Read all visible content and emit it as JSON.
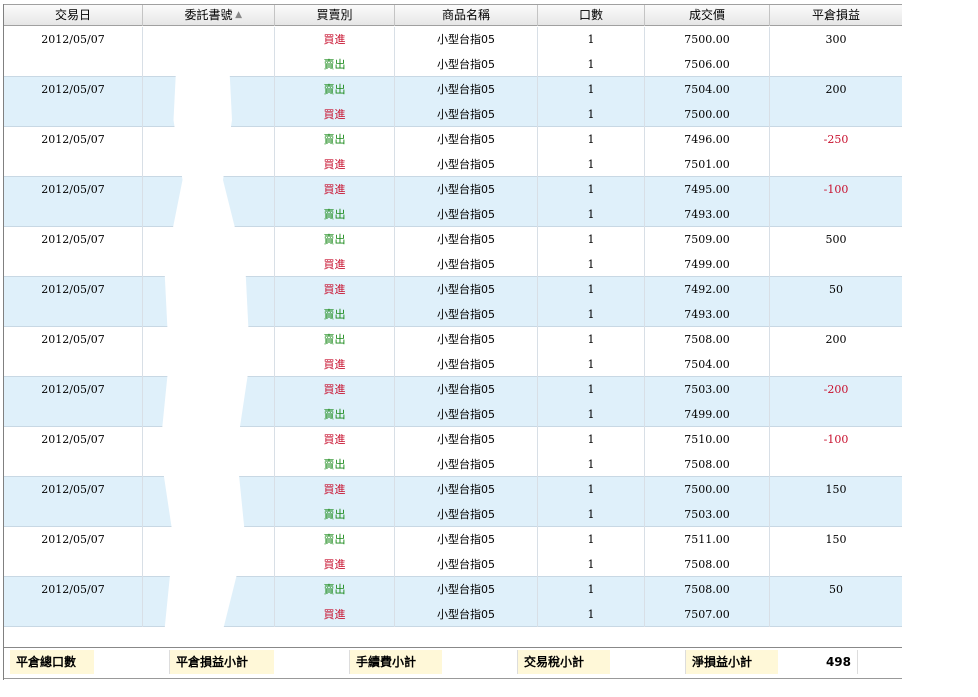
{
  "columns": [
    {
      "key": "date",
      "label": "交易日"
    },
    {
      "key": "order",
      "label": "委託書號"
    },
    {
      "key": "side",
      "label": "買賣別"
    },
    {
      "key": "product",
      "label": "商品名稱"
    },
    {
      "key": "qty",
      "label": "口數"
    },
    {
      "key": "price",
      "label": "成交價"
    },
    {
      "key": "pnl",
      "label": "平倉損益"
    }
  ],
  "sort_indicator": "▲",
  "rows": [
    {
      "date": "2012/05/07",
      "side": "買進",
      "product": "小型台指05",
      "qty": "1",
      "price": "7500.00",
      "pnl": "300"
    },
    {
      "date": "",
      "side": "賣出",
      "product": "小型台指05",
      "qty": "1",
      "price": "7506.00",
      "pnl": ""
    },
    {
      "date": "2012/05/07",
      "side": "賣出",
      "product": "小型台指05",
      "qty": "1",
      "price": "7504.00",
      "pnl": "200"
    },
    {
      "date": "",
      "side": "買進",
      "product": "小型台指05",
      "qty": "1",
      "price": "7500.00",
      "pnl": ""
    },
    {
      "date": "2012/05/07",
      "side": "賣出",
      "product": "小型台指05",
      "qty": "1",
      "price": "7496.00",
      "pnl": "-250"
    },
    {
      "date": "",
      "side": "買進",
      "product": "小型台指05",
      "qty": "1",
      "price": "7501.00",
      "pnl": ""
    },
    {
      "date": "2012/05/07",
      "side": "買進",
      "product": "小型台指05",
      "qty": "1",
      "price": "7495.00",
      "pnl": "-100"
    },
    {
      "date": "",
      "side": "賣出",
      "product": "小型台指05",
      "qty": "1",
      "price": "7493.00",
      "pnl": ""
    },
    {
      "date": "2012/05/07",
      "side": "賣出",
      "product": "小型台指05",
      "qty": "1",
      "price": "7509.00",
      "pnl": "500"
    },
    {
      "date": "",
      "side": "買進",
      "product": "小型台指05",
      "qty": "1",
      "price": "7499.00",
      "pnl": ""
    },
    {
      "date": "2012/05/07",
      "side": "買進",
      "product": "小型台指05",
      "qty": "1",
      "price": "7492.00",
      "pnl": "50"
    },
    {
      "date": "",
      "side": "賣出",
      "product": "小型台指05",
      "qty": "1",
      "price": "7493.00",
      "pnl": ""
    },
    {
      "date": "2012/05/07",
      "side": "賣出",
      "product": "小型台指05",
      "qty": "1",
      "price": "7508.00",
      "pnl": "200"
    },
    {
      "date": "",
      "side": "買進",
      "product": "小型台指05",
      "qty": "1",
      "price": "7504.00",
      "pnl": ""
    },
    {
      "date": "2012/05/07",
      "side": "買進",
      "product": "小型台指05",
      "qty": "1",
      "price": "7503.00",
      "pnl": "-200"
    },
    {
      "date": "",
      "side": "賣出",
      "product": "小型台指05",
      "qty": "1",
      "price": "7499.00",
      "pnl": ""
    },
    {
      "date": "2012/05/07",
      "side": "買進",
      "product": "小型台指05",
      "qty": "1",
      "price": "7510.00",
      "pnl": "-100"
    },
    {
      "date": "",
      "side": "賣出",
      "product": "小型台指05",
      "qty": "1",
      "price": "7508.00",
      "pnl": ""
    },
    {
      "date": "2012/05/07",
      "side": "買進",
      "product": "小型台指05",
      "qty": "1",
      "price": "7500.00",
      "pnl": "150"
    },
    {
      "date": "",
      "side": "賣出",
      "product": "小型台指05",
      "qty": "1",
      "price": "7503.00",
      "pnl": ""
    },
    {
      "date": "2012/05/07",
      "side": "賣出",
      "product": "小型台指05",
      "qty": "1",
      "price": "7511.00",
      "pnl": "150"
    },
    {
      "date": "",
      "side": "買進",
      "product": "小型台指05",
      "qty": "1",
      "price": "7508.00",
      "pnl": ""
    },
    {
      "date": "2012/05/07",
      "side": "賣出",
      "product": "小型台指05",
      "qty": "1",
      "price": "7508.00",
      "pnl": "50"
    },
    {
      "date": "",
      "side": "買進",
      "product": "小型台指05",
      "qty": "1",
      "price": "7507.00",
      "pnl": ""
    }
  ],
  "colors": {
    "buy": "#c8102e",
    "sell": "#1a8a1a",
    "row_alt": "#dff0fa",
    "footer_label_bg": "#fff8d8"
  },
  "footer": {
    "total_lots_label": "平倉總口數",
    "total_lots_value": "",
    "pnl_subtotal_label": "平倉損益小計",
    "pnl_subtotal_value": "",
    "fee_subtotal_label": "手續費小計",
    "fee_subtotal_value": "",
    "tax_subtotal_label": "交易稅小計",
    "tax_subtotal_value": "",
    "net_pnl_label": "淨損益小計",
    "net_pnl_value": "498"
  }
}
